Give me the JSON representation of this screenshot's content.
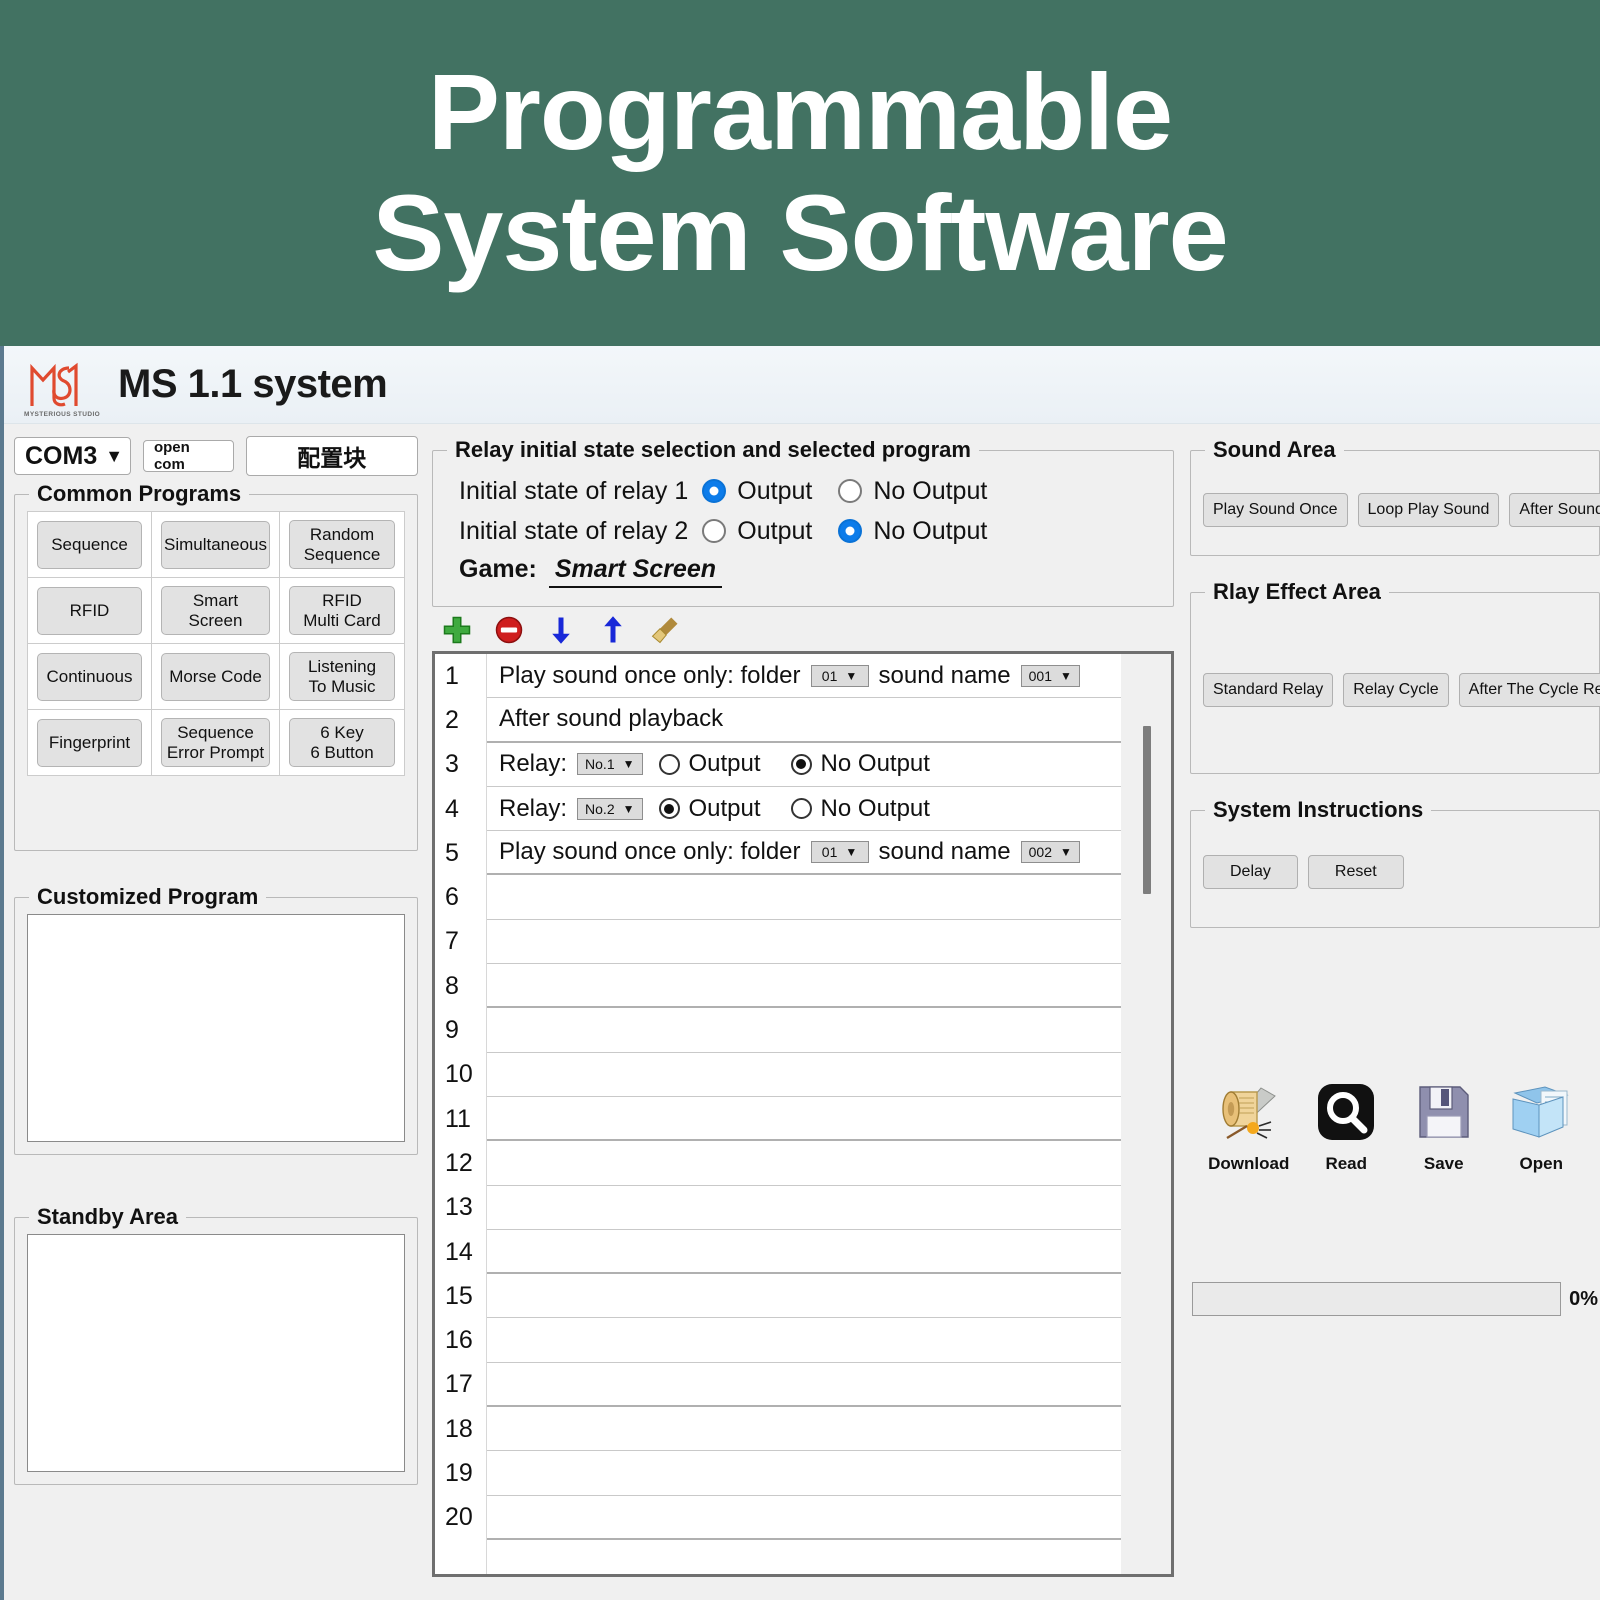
{
  "banner": {
    "line1": "Programmable",
    "line2": "System Software",
    "bg_color": "#427262",
    "text_color": "#ffffff"
  },
  "header": {
    "title": "MS 1.1 system",
    "logo_caption": "MYSTERIOUS STUDIO",
    "logo_color": "#e04a2f"
  },
  "top_controls": {
    "port_value": "COM3",
    "open_com_label": "open com",
    "config_block_label": "配置块"
  },
  "common_programs": {
    "legend": "Common Programs",
    "buttons": [
      "Sequence",
      "Simultaneous",
      "Random\nSequence",
      "RFID",
      "Smart\nScreen",
      "RFID\nMulti Card",
      "Continuous",
      "Morse Code",
      "Listening\nTo Music",
      "Fingerprint",
      "Sequence\nError Prompt",
      "6 Key\n6 Button"
    ]
  },
  "customized_program": {
    "legend": "Customized Program",
    "content": ""
  },
  "standby_area": {
    "legend": "Standby Area",
    "content": ""
  },
  "relay_panel": {
    "legend": "Relay initial state selection and selected program",
    "relay1": {
      "label": "Initial state of relay 1",
      "output_label": "Output",
      "no_output_label": "No Output",
      "selected": "Output"
    },
    "relay2": {
      "label": "Initial state of relay 2",
      "output_label": "Output",
      "no_output_label": "No Output",
      "selected": "No Output"
    },
    "game_label": "Game:",
    "game_value": "Smart Screen"
  },
  "toolbar": {
    "icons": [
      "add-icon",
      "delete-icon",
      "move-down-icon",
      "move-up-icon",
      "clear-broom-icon"
    ]
  },
  "program_list": {
    "row_numbers": [
      "1",
      "2",
      "3",
      "4",
      "5",
      "6",
      "7",
      "8",
      "9",
      "10",
      "11",
      "12",
      "13",
      "14",
      "15",
      "16",
      "17",
      "18",
      "19",
      "20"
    ],
    "rows": [
      {
        "type": "play_sound",
        "text_before": "Play sound once only: folder",
        "folder_value": "01",
        "text_middle": "sound name",
        "sound_value": "001"
      },
      {
        "type": "text",
        "text": "After sound playback"
      },
      {
        "type": "relay",
        "label": "Relay:",
        "relay_value": "No.1",
        "output_label": "Output",
        "no_output_label": "No Output",
        "selected": "No Output"
      },
      {
        "type": "relay",
        "label": "Relay:",
        "relay_value": "No.2",
        "output_label": "Output",
        "no_output_label": "No Output",
        "selected": "Output"
      },
      {
        "type": "play_sound",
        "text_before": "Play sound once only: folder",
        "folder_value": "01",
        "text_middle": "sound name",
        "sound_value": "002"
      }
    ]
  },
  "sound_area": {
    "legend": "Sound Area",
    "buttons": [
      "Play Sound Once",
      "Loop Play Sound",
      "After Sound Play"
    ]
  },
  "relay_effect_area": {
    "legend": "Rlay Effect Area",
    "buttons": [
      "Standard Relay",
      "Relay Cycle",
      "After The Cycle Relay"
    ]
  },
  "system_instructions": {
    "legend": "System Instructions",
    "buttons": [
      "Delay",
      "Reset"
    ]
  },
  "actions": [
    {
      "label": "Download",
      "icon": "scroll-quill-icon"
    },
    {
      "label": "Read",
      "icon": "magnifier-icon"
    },
    {
      "label": "Save",
      "icon": "floppy-disk-icon"
    },
    {
      "label": "Open",
      "icon": "open-folder-icon"
    }
  ],
  "progress": {
    "percent_label": "0%",
    "value": 0
  }
}
